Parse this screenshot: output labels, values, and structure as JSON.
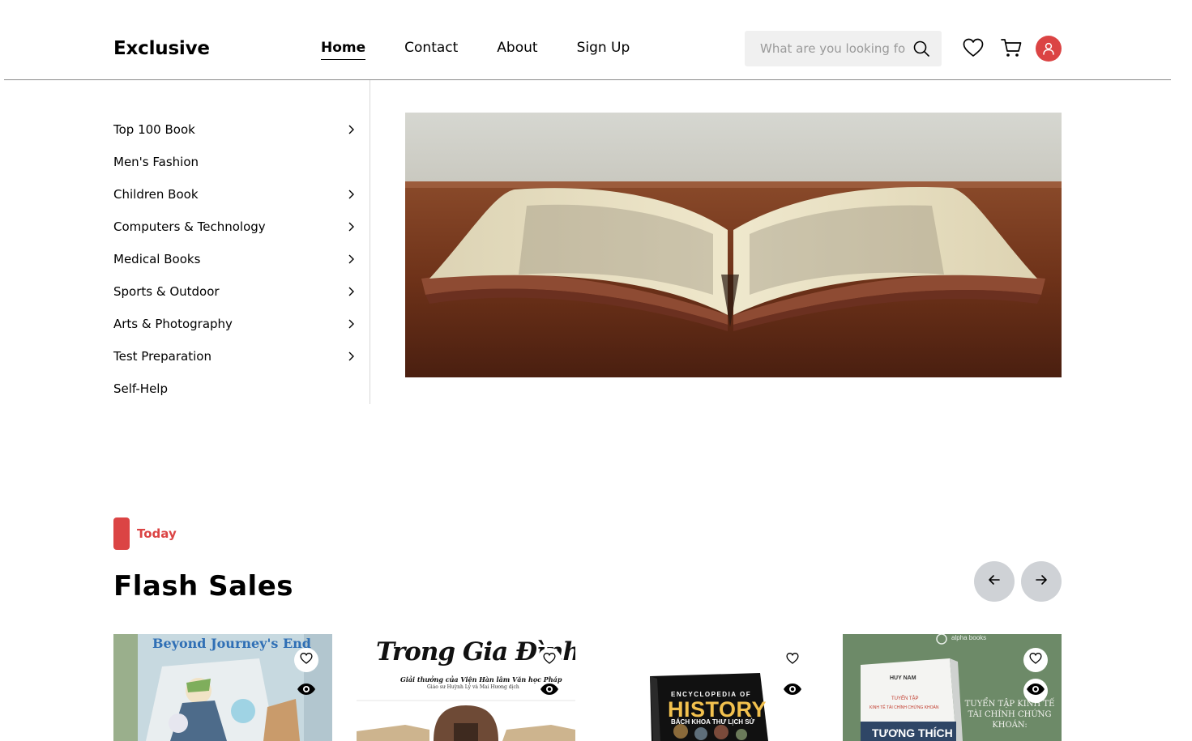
{
  "header": {
    "logo": "Exclusive",
    "nav": [
      {
        "label": "Home",
        "active": true
      },
      {
        "label": "Contact",
        "active": false
      },
      {
        "label": "About",
        "active": false
      },
      {
        "label": "Sign Up",
        "active": false
      }
    ],
    "search": {
      "placeholder": "What are you looking for?",
      "icon": "search-icon"
    },
    "icons": [
      "heart-icon",
      "cart-icon",
      "user-icon"
    ]
  },
  "sidebar": {
    "items": [
      {
        "label": "Top 100 Book",
        "has_arrow": true
      },
      {
        "label": "Men's Fashion",
        "has_arrow": false
      },
      {
        "label": "Children Book",
        "has_arrow": true
      },
      {
        "label": "Computers & Technology",
        "has_arrow": true
      },
      {
        "label": "Medical Books",
        "has_arrow": true
      },
      {
        "label": "Sports & Outdoor",
        "has_arrow": true
      },
      {
        "label": "Arts & Photography",
        "has_arrow": true
      },
      {
        "label": "Test Preparation",
        "has_arrow": true
      },
      {
        "label": "Self-Help",
        "has_arrow": false
      }
    ]
  },
  "hero": {
    "image": "open-book-on-wooden-table"
  },
  "flash_sales": {
    "tag": "Today",
    "title": "Flash Sales",
    "prev_icon": "arrow-left-icon",
    "next_icon": "arrow-right-icon",
    "products": [
      {
        "cover_title": "Beyond Journey's End"
      },
      {
        "cover_title": "Trong Gia Đình",
        "cover_subtitle": "Giải thưởng của Viện Hàn lâm Văn học Pháp",
        "cover_credit": "Giáo sư Huỳnh Lý và Mai Hương dịch"
      },
      {
        "cover_kicker": "ENCYCLOPEDIA OF",
        "cover_title": "HISTORY",
        "cover_subtitle": "BÁCH KHOA THƯ LỊCH SỬ"
      },
      {
        "cover_publisher": "alpha books",
        "cover_author": "HUY NAM",
        "cover_series": "TUYỂN TẬP",
        "cover_line": "KINH TẾ TÀI CHÍNH CHỨNG KHOÁN",
        "cover_title": "TƯƠNG THÍCH",
        "cover_side": "TUYỂN TẬP KINH TẾ TÀI CHÍNH CHỨNG KHOÁN:"
      }
    ]
  },
  "colors": {
    "accent": "#db4444",
    "search_bg": "#f0f0f0",
    "arrow_bg": "#cfd2d6"
  }
}
